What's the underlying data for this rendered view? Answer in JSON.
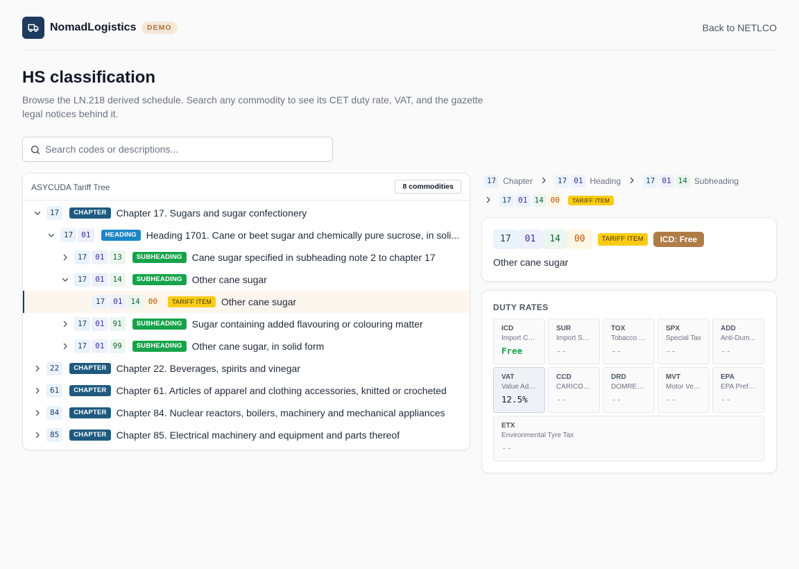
{
  "header": {
    "brand": "NomadLogistics",
    "badge": "DEMO",
    "back_link": "Back to NETLCO"
  },
  "page": {
    "title": "HS classification",
    "description": "Browse the LN.218 derived schedule. Search any commodity to see its CET duty rate, VAT, and the gazette legal notices behind it."
  },
  "search": {
    "placeholder": "Search codes or descriptions...",
    "value": ""
  },
  "tree": {
    "title": "ASYCUDA Tariff Tree",
    "count": "8 commodities",
    "rows": [
      {
        "codes": [
          "17"
        ],
        "badge": "CHAPTER",
        "label": "Chapter 17. Sugars and sugar confectionery",
        "state": "expanded"
      },
      {
        "codes": [
          "17",
          "01"
        ],
        "badge": "HEADING",
        "label": "Heading 1701. Cane or beet sugar and chemically pure sucrose, in soli...",
        "state": "expanded"
      },
      {
        "codes": [
          "17",
          "01",
          "13"
        ],
        "badge": "SUBHEADING",
        "label": "Cane sugar specified in subheading note 2 to chapter 17",
        "state": "collapsed"
      },
      {
        "codes": [
          "17",
          "01",
          "14"
        ],
        "badge": "SUBHEADING",
        "label": "Other cane sugar",
        "state": "expanded"
      },
      {
        "codes": [
          "17",
          "01",
          "14",
          "00"
        ],
        "badge": "TARIFF ITEM",
        "label": "Other cane sugar",
        "state": "leaf",
        "selected": true
      },
      {
        "codes": [
          "17",
          "01",
          "91"
        ],
        "badge": "SUBHEADING",
        "label": "Sugar containing added flavouring or colouring matter",
        "state": "collapsed"
      },
      {
        "codes": [
          "17",
          "01",
          "99"
        ],
        "badge": "SUBHEADING",
        "label": "Other cane sugar, in solid form",
        "state": "collapsed"
      },
      {
        "codes": [
          "22"
        ],
        "badge": "CHAPTER",
        "label": "Chapter 22. Beverages, spirits and vinegar",
        "state": "collapsed"
      },
      {
        "codes": [
          "61"
        ],
        "badge": "CHAPTER",
        "label": "Chapter 61. Articles of apparel and clothing accessories, knitted or crocheted",
        "state": "collapsed"
      },
      {
        "codes": [
          "84"
        ],
        "badge": "CHAPTER",
        "label": "Chapter 84. Nuclear reactors, boilers, machinery and mechanical appliances",
        "state": "collapsed"
      },
      {
        "codes": [
          "85"
        ],
        "badge": "CHAPTER",
        "label": "Chapter 85. Electrical machinery and equipment and parts thereof",
        "state": "collapsed"
      }
    ]
  },
  "breadcrumb": [
    {
      "codes": [
        "17"
      ],
      "label": "Chapter"
    },
    {
      "codes": [
        "17",
        "01"
      ],
      "label": "Heading"
    },
    {
      "codes": [
        "17",
        "01",
        "14"
      ],
      "label": "Subheading"
    },
    {
      "codes": [
        "17",
        "01",
        "14",
        "00"
      ],
      "badge": "TARIFF ITEM"
    }
  ],
  "detail": {
    "codes": [
      "17",
      "01",
      "14",
      "00"
    ],
    "badge": "TARIFF ITEM",
    "icd_pill": "ICD: Free",
    "description": "Other cane sugar"
  },
  "duty_rates": {
    "title": "DUTY RATES",
    "tiles": [
      {
        "code": "ICD",
        "name": "Import Cu...",
        "value": "Free",
        "style": "free"
      },
      {
        "code": "SUR",
        "name": "Import Su...",
        "value": "--"
      },
      {
        "code": "TOX",
        "name": "Tobacco T...",
        "value": "--"
      },
      {
        "code": "SPX",
        "name": "Special Tax",
        "value": "--"
      },
      {
        "code": "ADD",
        "name": "Anti-Dum...",
        "value": "--"
      },
      {
        "code": "VAT",
        "name": "Value Add...",
        "value": "12.5%",
        "style": "dark",
        "highlight": true
      },
      {
        "code": "CCD",
        "name": "CARICOM...",
        "value": "--"
      },
      {
        "code": "DRD",
        "name": "DOMREP ...",
        "value": "--"
      },
      {
        "code": "MVT",
        "name": "Motor Veh...",
        "value": "--"
      },
      {
        "code": "EPA",
        "name": "EPA Prefe...",
        "value": "--"
      },
      {
        "code": "ETX",
        "name": "Environmental Tyre Tax",
        "value": "--"
      }
    ]
  },
  "colors": {
    "brand": "#1e3a5f",
    "chapter": "#1e5a80",
    "heading": "#1a86c7",
    "subheading": "#16a34a",
    "tariff_item": "#facc15",
    "icd_pill": "#b07c45"
  }
}
